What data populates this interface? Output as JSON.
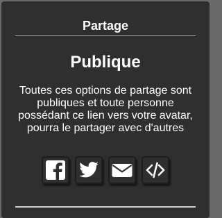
{
  "header": {
    "title": "Partage"
  },
  "visibility": {
    "title": "Publique",
    "description": "Toutes ces options de partage sont publiques et toute personne possédant ce lien vers votre avatar, pourra le partager avec d'autres"
  },
  "share_buttons": [
    {
      "icon": "facebook-icon"
    },
    {
      "icon": "twitter-icon"
    },
    {
      "icon": "email-icon"
    },
    {
      "icon": "embed-code-icon"
    }
  ],
  "colors": {
    "panel_background": "#2f2f2f",
    "outer_background": "#6a6a6a",
    "text": "#ffffff"
  }
}
